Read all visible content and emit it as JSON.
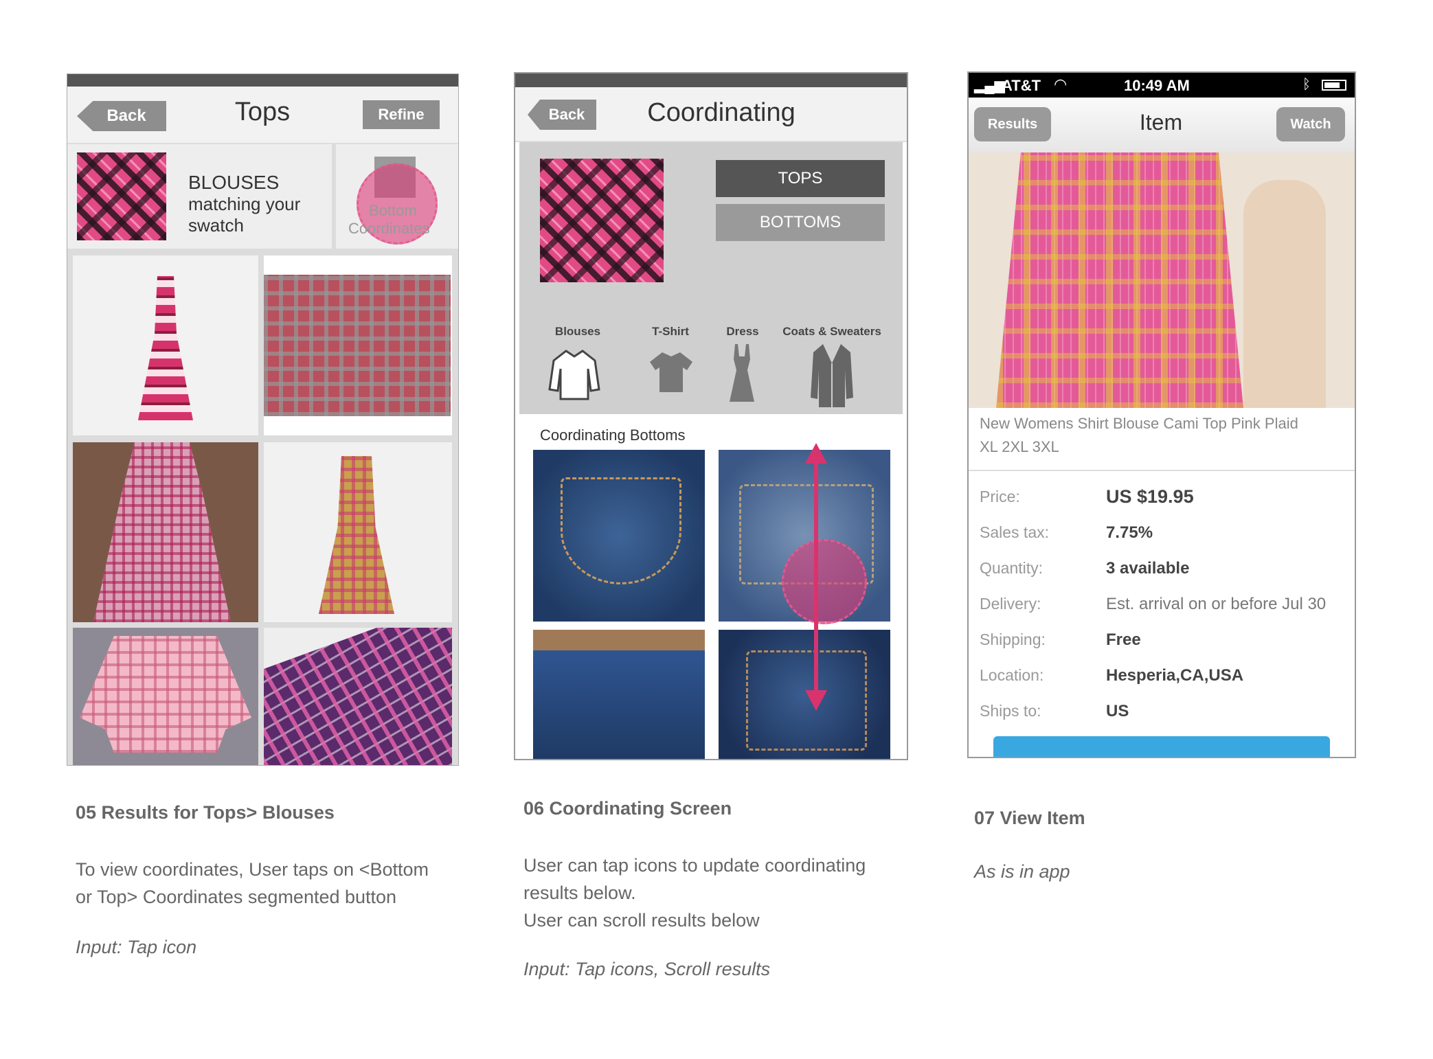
{
  "screen05": {
    "back": "Back",
    "title": "Tops",
    "refine": "Refine",
    "heading_line1": "BLOUSES",
    "heading_line2": "matching your",
    "heading_line3": "swatch",
    "bottom_coord_line1": "Bottom",
    "bottom_coord_line2": "Coordinates",
    "caption_title": "05 Results for  Tops> Blouses",
    "caption_line1": "To view coordinates, User taps on <Bottom",
    "caption_line2": "or Top> Coordinates segmented button",
    "caption_input": "Input: Tap icon"
  },
  "screen06": {
    "back": "Back",
    "title": "Coordinating",
    "tops": "TOPS",
    "bottoms": "BOTTOMS",
    "icons": [
      {
        "label": "Blouses",
        "icon": "blouse-icon"
      },
      {
        "label": "T-Shirt",
        "icon": "tshirt-icon"
      },
      {
        "label": "Dress",
        "icon": "dress-icon"
      },
      {
        "label": "Coats & Sweaters",
        "icon": "coat-icon"
      }
    ],
    "section_title": "Coordinating Bottoms",
    "caption_title": "06  Coordinating Screen",
    "caption_line1": "User can tap icons to update coordinating",
    "caption_line2": "results below.",
    "caption_line3": "User can scroll results below",
    "caption_input": "Input: Tap icons, Scroll results"
  },
  "screen07": {
    "status_carrier": "AT&T",
    "status_time": "10:49 AM",
    "results": "Results",
    "title": "Item",
    "watch": "Watch",
    "item_line1": "New Womens Shirt Blouse Cami Top Pink Plaid",
    "item_line2": "XL 2XL 3XL",
    "details": [
      {
        "label": "Price:",
        "value": "US $19.95"
      },
      {
        "label": "Sales tax:",
        "value": "7.75%"
      },
      {
        "label": "Quantity:",
        "value": "3 available"
      },
      {
        "label": "Delivery:",
        "value": "Est. arrival on or before Jul 30"
      },
      {
        "label": "Shipping:",
        "value": "Free"
      },
      {
        "label": "Location:",
        "value": "Hesperia,CA,USA"
      },
      {
        "label": "Ships to:",
        "value": "US"
      }
    ],
    "caption_title": "07 View Item",
    "caption_input": "As is in app"
  },
  "colors": {
    "accent_pink": "#e0407f",
    "button_gray": "#8e8e8e",
    "buy_blue": "#3aa8e0"
  }
}
